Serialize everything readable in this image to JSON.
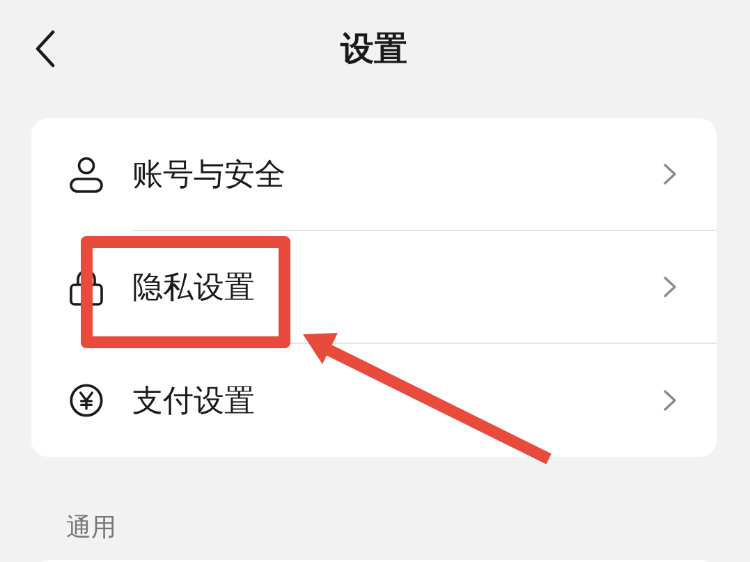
{
  "title": "设置",
  "groups": [
    {
      "items": [
        {
          "kind": "person",
          "label": "账号与安全",
          "highlighted": false
        },
        {
          "kind": "lock",
          "label": "隐私设置",
          "highlighted": true
        },
        {
          "kind": "yen",
          "label": "支付设置",
          "highlighted": false
        }
      ]
    },
    {
      "header": "通用"
    }
  ]
}
